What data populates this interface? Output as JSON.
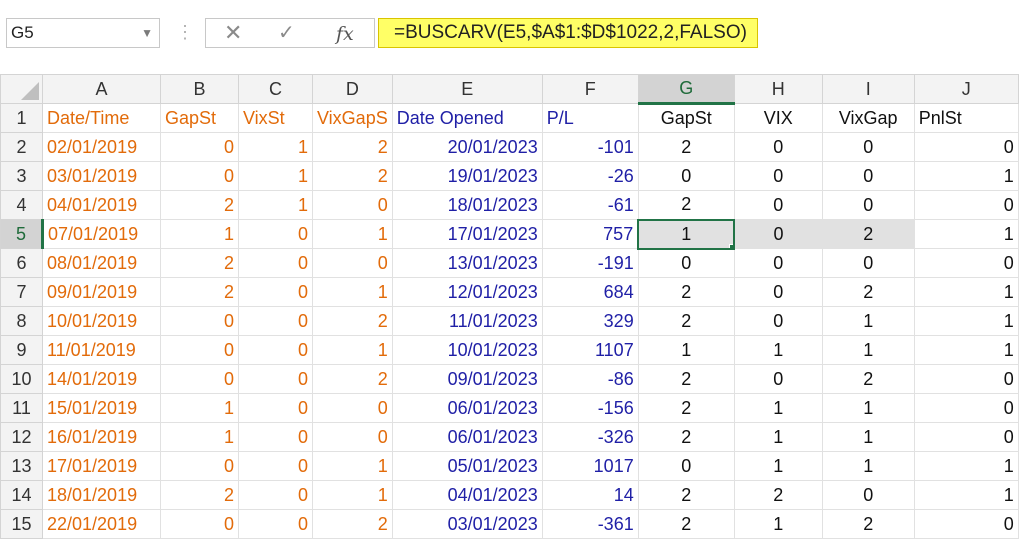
{
  "formula_bar": {
    "name_box": "G5",
    "formula": "=BUSCARV(E5,$A$1:$D$1022,2,FALSO)"
  },
  "grid": {
    "columns": [
      "A",
      "B",
      "C",
      "D",
      "E",
      "F",
      "G",
      "H",
      "I",
      "J"
    ],
    "selected_column": "G",
    "selected_row": 5,
    "headers": [
      "Date/Time",
      "GapSt",
      "VixSt",
      "VixGapS",
      "Date Opened",
      "P/L",
      "GapSt",
      "VIX",
      "VixGap",
      "PnlSt"
    ],
    "rows": [
      {
        "n": "2",
        "date": "02/01/2019",
        "gapst": "0",
        "vixst": "1",
        "vixgaps": "2",
        "opened": "20/01/2023",
        "pl": "-101",
        "g": "2",
        "h": "0",
        "i": "0",
        "j": "0"
      },
      {
        "n": "3",
        "date": "03/01/2019",
        "gapst": "0",
        "vixst": "1",
        "vixgaps": "2",
        "opened": "19/01/2023",
        "pl": "-26",
        "g": "0",
        "h": "0",
        "i": "0",
        "j": "1"
      },
      {
        "n": "4",
        "date": "04/01/2019",
        "gapst": "2",
        "vixst": "1",
        "vixgaps": "0",
        "opened": "18/01/2023",
        "pl": "-61",
        "g": "2",
        "h": "0",
        "i": "0",
        "j": "0"
      },
      {
        "n": "5",
        "date": "07/01/2019",
        "gapst": "1",
        "vixst": "0",
        "vixgaps": "1",
        "opened": "17/01/2023",
        "pl": "757",
        "g": "1",
        "h": "0",
        "i": "2",
        "j": "1"
      },
      {
        "n": "6",
        "date": "08/01/2019",
        "gapst": "2",
        "vixst": "0",
        "vixgaps": "0",
        "opened": "13/01/2023",
        "pl": "-191",
        "g": "0",
        "h": "0",
        "i": "0",
        "j": "0"
      },
      {
        "n": "7",
        "date": "09/01/2019",
        "gapst": "2",
        "vixst": "0",
        "vixgaps": "1",
        "opened": "12/01/2023",
        "pl": "684",
        "g": "2",
        "h": "0",
        "i": "2",
        "j": "1"
      },
      {
        "n": "8",
        "date": "10/01/2019",
        "gapst": "0",
        "vixst": "0",
        "vixgaps": "2",
        "opened": "11/01/2023",
        "pl": "329",
        "g": "2",
        "h": "0",
        "i": "1",
        "j": "1"
      },
      {
        "n": "9",
        "date": "11/01/2019",
        "gapst": "0",
        "vixst": "0",
        "vixgaps": "1",
        "opened": "10/01/2023",
        "pl": "1107",
        "g": "1",
        "h": "1",
        "i": "1",
        "j": "1"
      },
      {
        "n": "10",
        "date": "14/01/2019",
        "gapst": "0",
        "vixst": "0",
        "vixgaps": "2",
        "opened": "09/01/2023",
        "pl": "-86",
        "g": "2",
        "h": "0",
        "i": "2",
        "j": "0"
      },
      {
        "n": "11",
        "date": "15/01/2019",
        "gapst": "1",
        "vixst": "0",
        "vixgaps": "0",
        "opened": "06/01/2023",
        "pl": "-156",
        "g": "2",
        "h": "1",
        "i": "1",
        "j": "0"
      },
      {
        "n": "12",
        "date": "16/01/2019",
        "gapst": "1",
        "vixst": "0",
        "vixgaps": "0",
        "opened": "06/01/2023",
        "pl": "-326",
        "g": "2",
        "h": "1",
        "i": "1",
        "j": "0"
      },
      {
        "n": "13",
        "date": "17/01/2019",
        "gapst": "0",
        "vixst": "0",
        "vixgaps": "1",
        "opened": "05/01/2023",
        "pl": "1017",
        "g": "0",
        "h": "1",
        "i": "1",
        "j": "1"
      },
      {
        "n": "14",
        "date": "18/01/2019",
        "gapst": "2",
        "vixst": "0",
        "vixgaps": "1",
        "opened": "04/01/2023",
        "pl": "14",
        "g": "2",
        "h": "2",
        "i": "0",
        "j": "1"
      },
      {
        "n": "15",
        "date": "22/01/2019",
        "gapst": "0",
        "vixst": "0",
        "vixgaps": "2",
        "opened": "03/01/2023",
        "pl": "-361",
        "g": "2",
        "h": "1",
        "i": "2",
        "j": "0"
      }
    ]
  },
  "colors": {
    "orange_text": "#e26b0a",
    "blue_text": "#1f1fa6",
    "formula_highlight": "#ffff66",
    "selection_green": "#217346"
  },
  "icons": {
    "cancel": "close-icon",
    "enter": "check-icon",
    "function": "fx-icon",
    "name_box_dropdown": "chevron-down-icon"
  }
}
